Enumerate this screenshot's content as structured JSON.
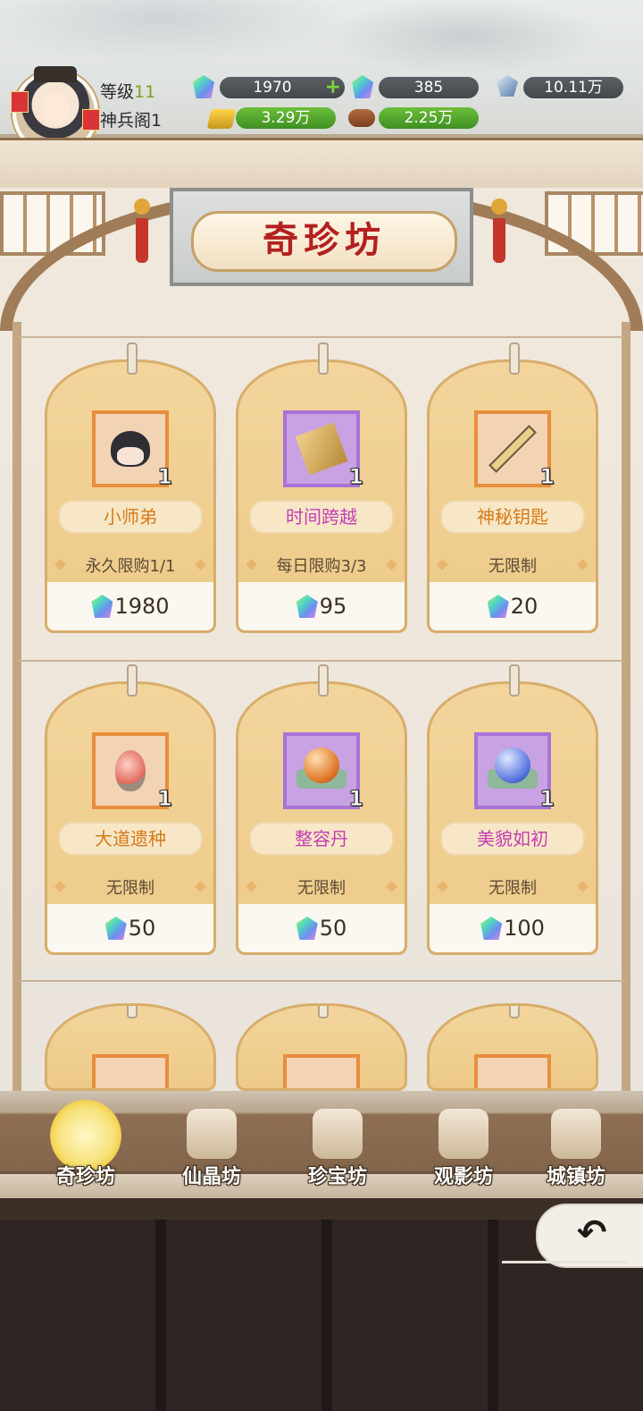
{
  "player": {
    "level_label": "等级",
    "level_value": "11",
    "rank_label": "神兵阁1"
  },
  "resources": {
    "gem_primary": "1970",
    "gem_secondary": "385",
    "crystal": "10.11万",
    "gold": "3.29万",
    "wood": "2.25万"
  },
  "shop": {
    "title": "奇珍坊",
    "items": [
      {
        "name": "小师弟",
        "qty": "1",
        "limit": "永久限购1/1",
        "price": "1980"
      },
      {
        "name": "时间跨越",
        "qty": "1",
        "limit": "每日限购3/3",
        "price": "95"
      },
      {
        "name": "神秘钥匙",
        "qty": "1",
        "limit": "无限制",
        "price": "20"
      },
      {
        "name": "大道遗种",
        "qty": "1",
        "limit": "无限制",
        "price": "50"
      },
      {
        "name": "整容丹",
        "qty": "1",
        "limit": "无限制",
        "price": "50"
      },
      {
        "name": "美貌如初",
        "qty": "1",
        "limit": "无限制",
        "price": "100"
      }
    ]
  },
  "nav": {
    "items": [
      {
        "label": "奇珍坊",
        "active": true
      },
      {
        "label": "仙晶坊"
      },
      {
        "label": "珍宝坊"
      },
      {
        "label": "观影坊"
      },
      {
        "label": "城镇坊"
      }
    ]
  },
  "icons": {
    "back": "back-arrow-icon"
  }
}
